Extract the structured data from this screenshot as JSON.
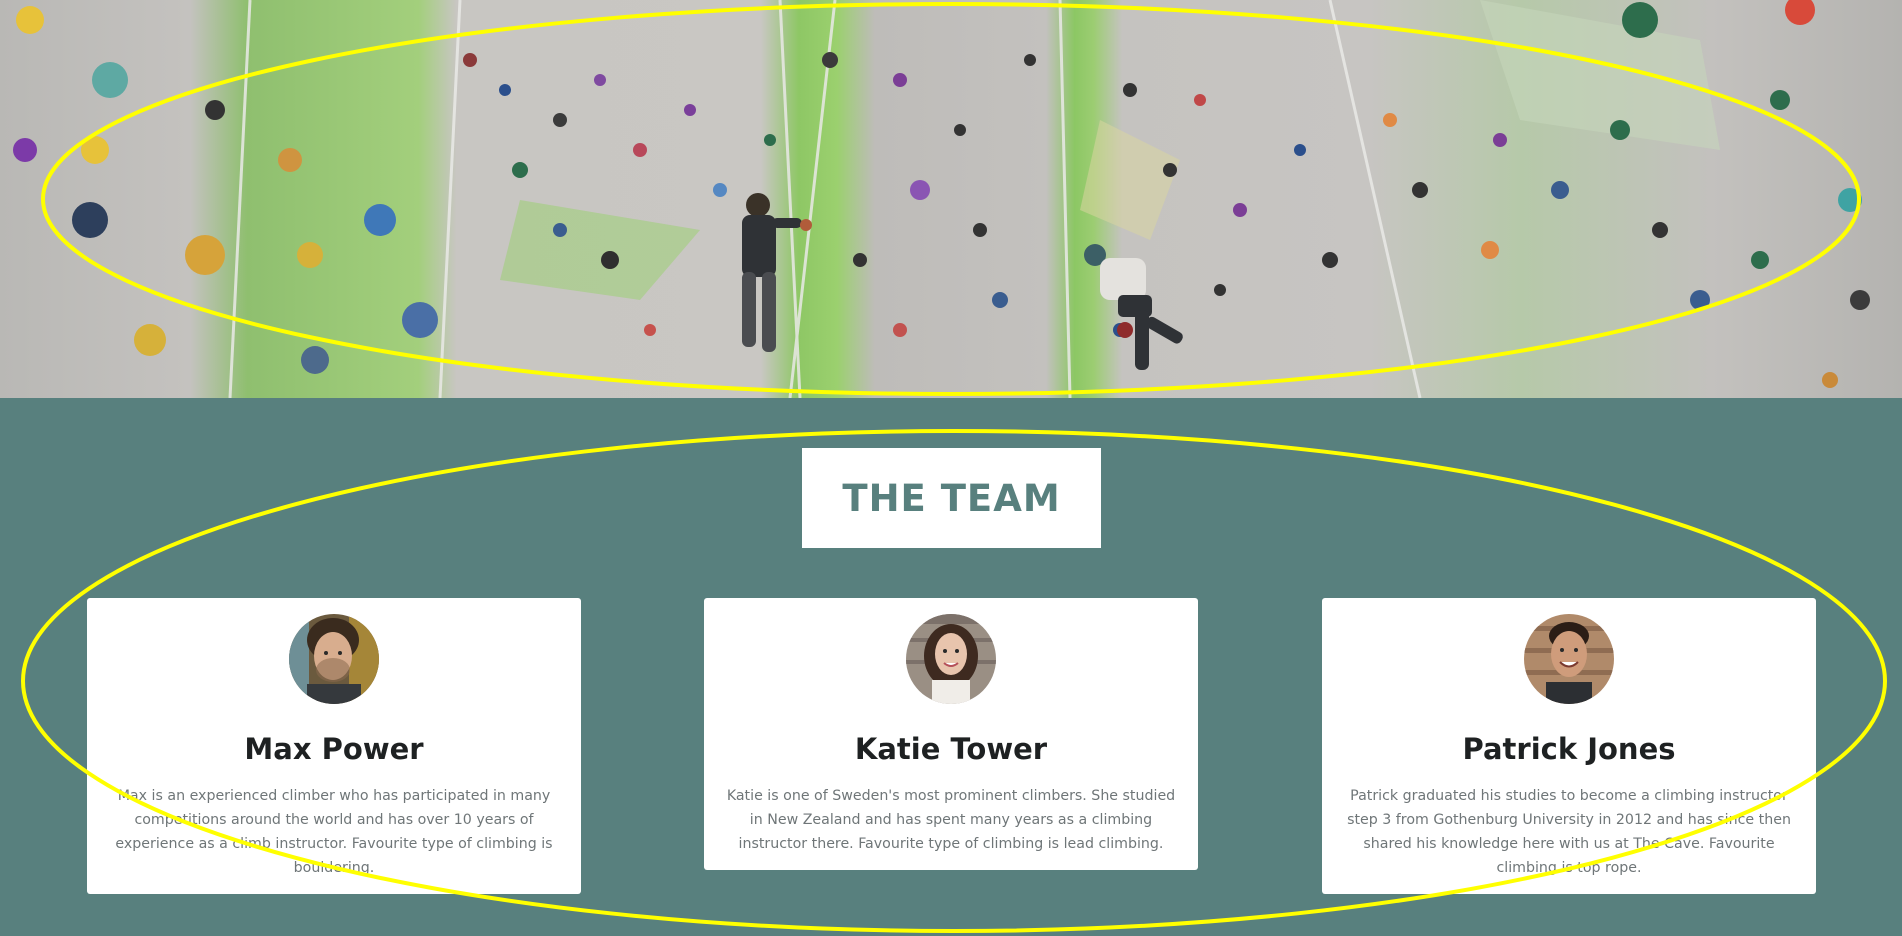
{
  "hero": {
    "image": "indoor climbing wall with two climbers"
  },
  "team": {
    "heading": "THE TEAM",
    "members": [
      {
        "name": "Max Power",
        "bio": "Max is an experienced climber who has participated in many competitions around the world and has over 10 years of experience as a climb instructor. Favourite type of climbing is bouldering.",
        "avatar": "man-portrait-avatar"
      },
      {
        "name": "Katie Tower",
        "bio": "Katie is one of Sweden's most prominent climbers. She studied in New Zealand and has spent many years as a climbing instructor there. Favourite type of climbing is lead climbing.",
        "avatar": "woman-portrait-avatar"
      },
      {
        "name": "Patrick Jones",
        "bio": "Patrick graduated his studies to become a climbing instructor step 3 from Gothenburg University in 2012 and has since then shared his knowledge here with us at The Cave. Favourite climbing is top rope.",
        "avatar": "man-smiling-portrait-avatar"
      }
    ]
  },
  "colors": {
    "section_bg": "#58807e",
    "heading": "#58807e",
    "name": "#1e2122",
    "bio": "#6f7678",
    "annotation": "#ffff00"
  }
}
